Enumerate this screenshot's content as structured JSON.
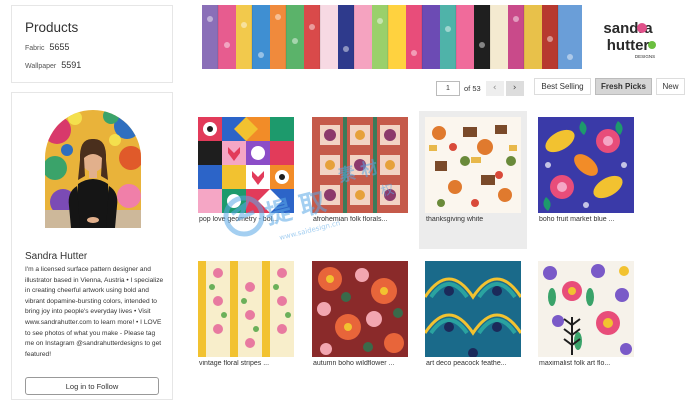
{
  "products": {
    "title": "Products",
    "rows": [
      {
        "label": "Fabric",
        "count": "5655"
      },
      {
        "label": "Wallpaper",
        "count": "5591"
      }
    ]
  },
  "profile": {
    "name": "Sandra Hutter",
    "bio": "I'm a licensed surface pattern designer and illustrator based in Vienna, Austria • I specialize in creating cheerful artwork using bold and vibrant dopamine-bursting colors, intended to bring joy into people's everyday lives • Visit www.sandrahutter.com to learn more! • I LOVE to see photos of what you make - Please tag me on Instagram @sandrahutterdesigns to get featured!",
    "follow_label": "Log in to Follow"
  },
  "banner": {
    "brand_line1": "sandra",
    "brand_line2": "hutter",
    "brand_tagline": "DESIGNS"
  },
  "pager": {
    "current_page": "1",
    "total_text": "of 53",
    "prev_icon": "‹",
    "next_icon": "›"
  },
  "sort": {
    "options": [
      "Best Selling",
      "Fresh Picks",
      "New"
    ],
    "selected": "Fresh Picks"
  },
  "designs": [
    {
      "title": "pop love geometry - bol..."
    },
    {
      "title": "afrohemian folk florals..."
    },
    {
      "title": "thanksgiving white"
    },
    {
      "title": "boho fruit market blue ..."
    },
    {
      "title": "vintage floral stripes ..."
    },
    {
      "title": "autumn boho wildflower ..."
    },
    {
      "title": "art deco peacock feathe..."
    },
    {
      "title": "maximalist folk art flo..."
    }
  ],
  "watermark": {
    "url": "www.saidesign.cn"
  },
  "colors": {
    "accent_pink": "#e0518a",
    "brand_green": "#6bbf3f",
    "watermark_blue": "#5aa8e6"
  }
}
